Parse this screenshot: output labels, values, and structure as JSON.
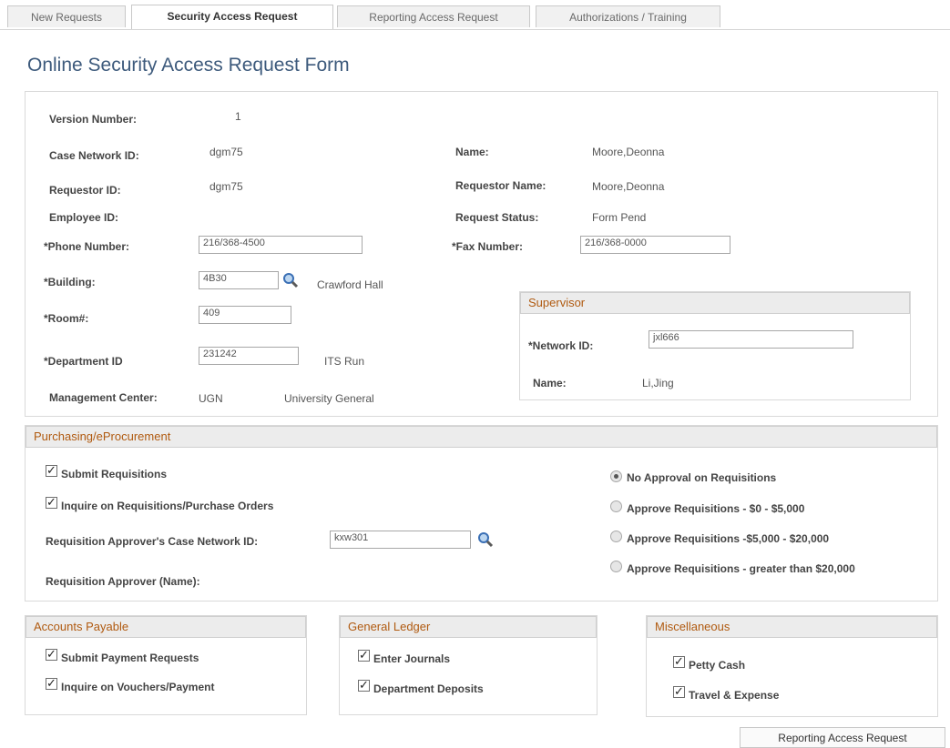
{
  "tabs": [
    "New Requests",
    "Security Access Request",
    "Reporting Access Request",
    "Authorizations / Training"
  ],
  "page_title": "Online Security Access Request Form",
  "info": {
    "version_label": "Version Number:",
    "version_value": "1",
    "case_net_label": "Case Network ID:",
    "case_net_value": "dgm75",
    "name_label": "Name:",
    "name_value": "Moore,Deonna",
    "requestor_id_label": "Requestor ID:",
    "requestor_id_value": "dgm75",
    "requestor_name_label": "Requestor Name:",
    "requestor_name_value": "Moore,Deonna",
    "employee_id_label": "Employee ID:",
    "request_status_label": "Request Status:",
    "request_status_value": "Form Pend",
    "phone_label": "*Phone Number:",
    "phone_value": "216/368-4500",
    "fax_label": "*Fax Number:",
    "fax_value": "216/368-0000",
    "building_label": "*Building:",
    "building_value": "4B30",
    "building_name": "Crawford Hall",
    "room_label": "*Room#:",
    "room_value": "409",
    "dept_label": "*Department ID",
    "dept_value": "231242",
    "dept_name": "ITS Run",
    "mgmt_label": "Management Center:",
    "mgmt_code": "UGN",
    "mgmt_name": "University General"
  },
  "supervisor": {
    "header": "Supervisor",
    "net_label": "*Network ID:",
    "net_value": "jxl666",
    "name_label": "Name:",
    "name_value": "Li,Jing"
  },
  "purchasing": {
    "header": "Purchasing/eProcurement",
    "submit_req": "Submit Requisitions",
    "inquire_req": "Inquire on Requisitions/Purchase Orders",
    "approver_id_label": "Requisition Approver's Case Network ID:",
    "approver_id_value": "kxw301",
    "approver_name_label": "Requisition Approver (Name):",
    "radio_options": [
      "No Approval on Requisitions",
      "Approve Requisitions - $0 - $5,000",
      "Approve Requisitions -$5,000 - $20,000",
      "Approve Requisitions - greater than $20,000"
    ]
  },
  "accounts_payable": {
    "header": "Accounts Payable",
    "items": [
      "Submit Payment Requests",
      "Inquire on Vouchers/Payment"
    ]
  },
  "general_ledger": {
    "header": "General Ledger",
    "items": [
      "Enter Journals",
      "Department Deposits"
    ]
  },
  "misc": {
    "header": "Miscellaneous",
    "items": [
      "Petty Cash",
      "Travel & Expense"
    ]
  },
  "footer_button": "Reporting Access Request"
}
